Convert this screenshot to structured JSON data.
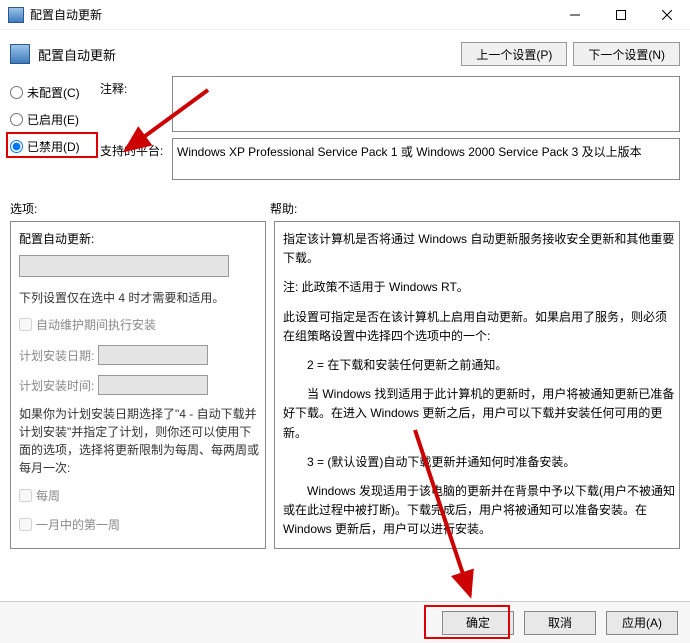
{
  "window": {
    "title": "配置自动更新"
  },
  "header": {
    "title": "配置自动更新",
    "prev": "上一个设置(P)",
    "next": "下一个设置(N)"
  },
  "radios": {
    "not_configured": "未配置(C)",
    "enabled": "已启用(E)",
    "disabled": "已禁用(D)"
  },
  "fields": {
    "comment_label": "注释:",
    "platform_label": "支持的平台:",
    "platform_text": "Windows XP Professional Service Pack 1 或 Windows 2000 Service Pack 3 及以上版本"
  },
  "labels": {
    "options": "选项:",
    "help": "帮助:"
  },
  "options": {
    "title": "配置自动更新:",
    "note": "下列设置仅在选中 4 时才需要和适用。",
    "maint_check": "自动维护期间执行安装",
    "install_day_label": "计划安装日期:",
    "install_time_label": "计划安装时间:",
    "para1": "如果你为计划安装日期选择了\"4 - 自动下载并计划安装\"并指定了计划，则你还可以使用下面的选项，选择将更新限制为每周、每两周或每月一次:",
    "weekly": "每周",
    "first_week": "一月中的第一周"
  },
  "help": {
    "p1": "指定该计算机是否将通过 Windows 自动更新服务接收安全更新和其他重要下载。",
    "p2": "注: 此政策不适用于 Windows RT。",
    "p3": "此设置可指定是否在该计算机上启用自动更新。如果启用了服务，则必须在组策略设置中选择四个选项中的一个:",
    "p4": "2 = 在下载和安装任何更新之前通知。",
    "p5": "当 Windows 找到适用于此计算机的更新时，用户将被通知更新已准备好下载。在进入 Windows 更新之后，用户可以下载并安装任何可用的更新。",
    "p6": "3 = (默认设置)自动下载更新并通知何时准备安装。",
    "p7": "Windows 发现适用于该电脑的更新并在背景中予以下载(用户不被通知或在此过程中被打断)。下载完成后，用户将被通知可以准备安装。在 Windows 更新后，用户可以进行安装。"
  },
  "buttons": {
    "ok": "确定",
    "cancel": "取消",
    "apply": "应用(A)"
  }
}
